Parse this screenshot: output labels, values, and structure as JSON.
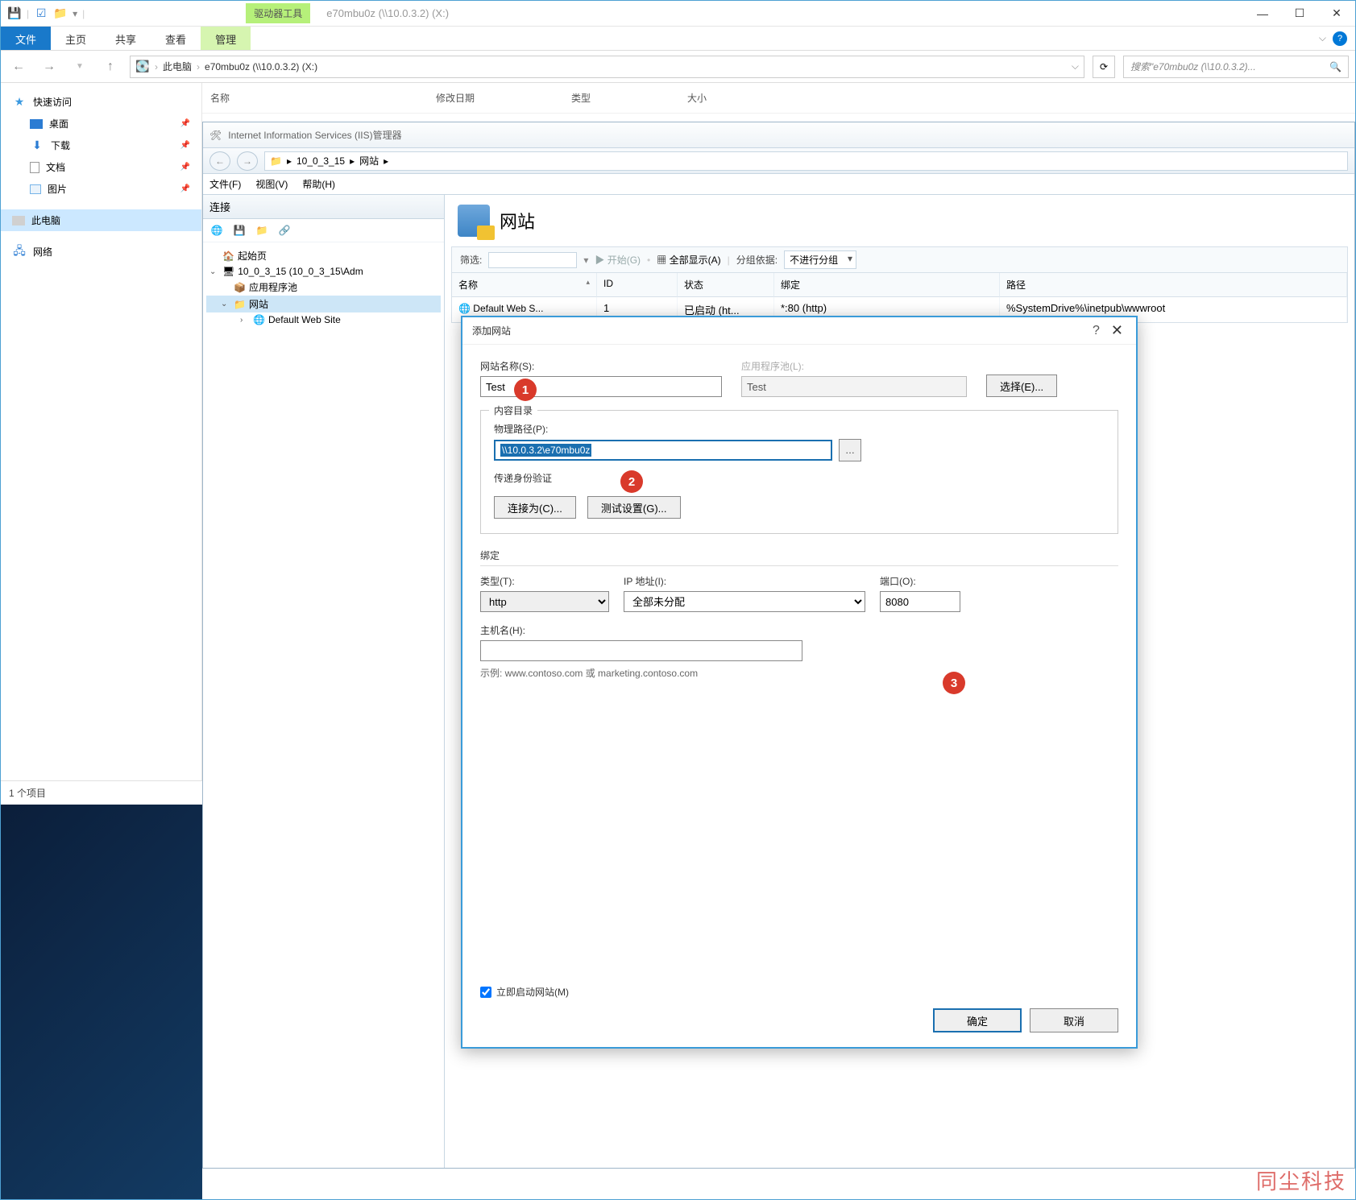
{
  "explorer": {
    "tool_tab": "驱动器工具",
    "title": "e70mbu0z (\\\\10.0.3.2) (X:)",
    "tabs": {
      "file": "文件",
      "home": "主页",
      "share": "共享",
      "view": "查看",
      "manage": "管理"
    },
    "breadcrumb": {
      "root": "此电脑",
      "current": "e70mbu0z (\\\\10.0.3.2) (X:)"
    },
    "search_placeholder": "搜索\"e70mbu0z (\\\\10.0.3.2)... ",
    "columns": {
      "name": "名称",
      "date": "修改日期",
      "type": "类型",
      "size": "大小"
    },
    "status": "1 个项目"
  },
  "sidebar": {
    "quick_access": "快速访问",
    "items": [
      {
        "label": "桌面"
      },
      {
        "label": "下载"
      },
      {
        "label": "文档"
      },
      {
        "label": "图片"
      }
    ],
    "this_pc": "此电脑",
    "network": "网络"
  },
  "iis": {
    "title": "Internet Information Services (IIS)管理器",
    "path": {
      "server": "10_0_3_15",
      "node": "网站"
    },
    "menu": {
      "file": "文件(F)",
      "view": "视图(V)",
      "help": "帮助(H)"
    },
    "tree": {
      "title": "连接",
      "start": "起始页",
      "server": "10_0_3_15 (10_0_3_15\\Adm",
      "apppools": "应用程序池",
      "sites": "网站",
      "default_site": "Default Web Site"
    },
    "main": {
      "heading": "网站",
      "filter_label": "筛选:",
      "start_btn": "开始(G)",
      "show_all": "全部显示(A)",
      "group_by": "分组依据:",
      "group_value": "不进行分组",
      "cols": {
        "name": "名称",
        "id": "ID",
        "status": "状态",
        "binding": "绑定",
        "path": "路径"
      },
      "row": {
        "name": "Default Web S...",
        "id": "1",
        "status": "已启动 (ht...",
        "binding": "*:80 (http)",
        "path": "%SystemDrive%\\inetpub\\wwwroot"
      }
    }
  },
  "dialog": {
    "title": "添加网站",
    "site_name_label": "网站名称(S):",
    "site_name_value": "Test",
    "apppool_label": "应用程序池(L):",
    "apppool_value": "Test",
    "select_btn": "选择(E)...",
    "content_legend": "内容目录",
    "physical_path_label": "物理路径(P):",
    "physical_path_value": "\\\\10.0.3.2\\e70mbu0z",
    "passthrough": "传递身份验证",
    "connect_as": "连接为(C)...",
    "test_settings": "测试设置(G)...",
    "binding_heading": "绑定",
    "type_label": "类型(T):",
    "type_value": "http",
    "ip_label": "IP 地址(I):",
    "ip_value": "全部未分配",
    "port_label": "端口(O):",
    "port_value": "8080",
    "hostname_label": "主机名(H):",
    "hostname_value": "",
    "example": "示例: www.contoso.com 或 marketing.contoso.com",
    "start_immediately": "立即启动网站(M)",
    "ok": "确定",
    "cancel": "取消"
  },
  "badges": {
    "b1": "1",
    "b2": "2",
    "b3": "3"
  },
  "watermark": "同尘科技"
}
